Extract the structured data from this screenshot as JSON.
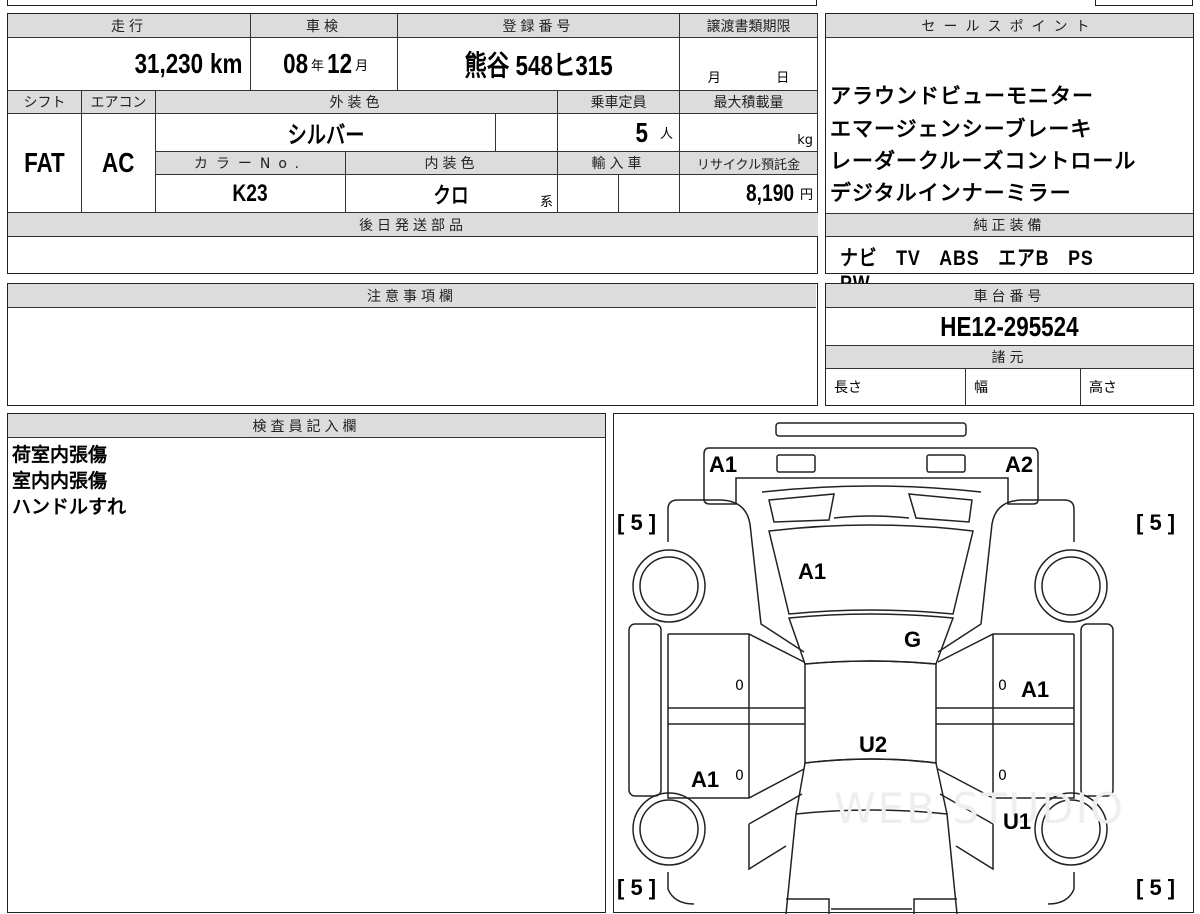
{
  "vehicle": {
    "mileage_label": "走行",
    "mileage": "31,230",
    "mileage_unit": "km",
    "inspection_label": "車検",
    "inspection_year": "08",
    "year_unit": "年",
    "inspection_month": "12",
    "month_unit": "月",
    "registration_label": "登録番号",
    "registration": "熊谷 548ヒ315",
    "transfer_label": "譲渡書類期限",
    "transfer_month": "月",
    "transfer_day": "日",
    "shift_label": "シフト",
    "shift": "FAT",
    "aircon_label": "エアコン",
    "aircon": "AC",
    "exterior_color_label": "外装色",
    "exterior_color": "シルバー",
    "capacity_label": "乗車定員",
    "capacity": "5",
    "capacity_unit": "人",
    "max_load_label": "最大積載量",
    "max_load_unit": "kg",
    "color_no_label": "カラーNo.",
    "color_no": "K23",
    "interior_color_label": "内装色",
    "interior_color": "クロ",
    "interior_suffix": "系",
    "import_label": "輸入車",
    "recycle_label": "リサイクル預託金",
    "recycle": "8,190",
    "recycle_unit": "円",
    "later_parts_label": "後日発送部品"
  },
  "sales_points": {
    "label": "セールスポイント",
    "items": [
      "アラウンドビューモニター",
      "エマージェンシーブレーキ",
      "レーダークルーズコントロール",
      "デジタルインナーミラー"
    ]
  },
  "equipment": {
    "label": "純正装備",
    "value": "ナビ　TV　ABS　エアB　PS　PW"
  },
  "notes": {
    "label": "注意事項欄"
  },
  "chassis": {
    "label": "車台番号",
    "value": "HE12-295524",
    "spec_label": "諸元",
    "length": "長さ",
    "width": "幅",
    "height": "高さ"
  },
  "inspector": {
    "label": "検査員記入欄",
    "lines": [
      "荷室内張傷",
      "室内内張傷",
      "ハンドルすれ"
    ]
  },
  "diagram": {
    "tire_marks": [
      "[ 5 ]",
      "[ 5 ]",
      "[ 5 ]",
      "[ 5 ]"
    ],
    "marks": {
      "rear_left": "A1",
      "rear_right": "A2",
      "rear_glass": "A1",
      "glass": "G",
      "roof": "U2",
      "right_door": "A1",
      "left_door": "A1",
      "right_front": "U1",
      "zero": "0"
    },
    "watermark": "WEB STUDIO"
  }
}
